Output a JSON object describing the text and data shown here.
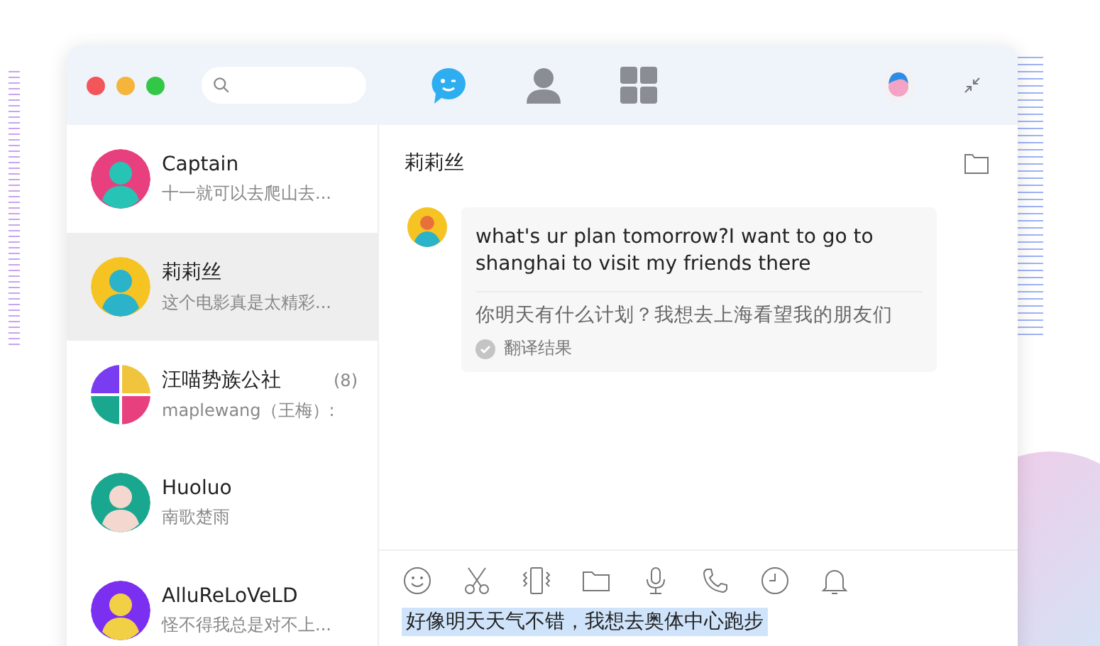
{
  "nav_tabs": [
    {
      "kind": "chat",
      "selected": true
    },
    {
      "kind": "contacts",
      "selected": false
    },
    {
      "kind": "apps",
      "selected": false
    }
  ],
  "contacts": [
    {
      "kind": "person",
      "name": "Captain",
      "preview": "十一就可以去爬山去...",
      "selected": false
    },
    {
      "kind": "person",
      "name": "莉莉丝",
      "preview": "这个电影真是太精彩...",
      "selected": true
    },
    {
      "kind": "group",
      "name": "汪喵势族公社",
      "preview": "maplewang（王梅）:",
      "badge": "(8)",
      "selected": false
    },
    {
      "kind": "person",
      "name": "Huoluo",
      "preview": "南歌楚雨",
      "selected": false
    },
    {
      "kind": "person",
      "name": "AlluReLoVeLD",
      "preview": "怪不得我总是对不上...",
      "selected": false
    }
  ],
  "chat": {
    "title": "莉莉丝",
    "messages": [
      {
        "text": "what's ur plan tomorrow?I want to go to shanghai to visit my friends there",
        "translation": "你明天有什么计划？我想去上海看望我的朋友们",
        "translation_label": "翻译结果"
      }
    ],
    "input": {
      "value": "好像明天天气不错，我想去奥体中心跑步",
      "highlighted": true
    }
  }
}
